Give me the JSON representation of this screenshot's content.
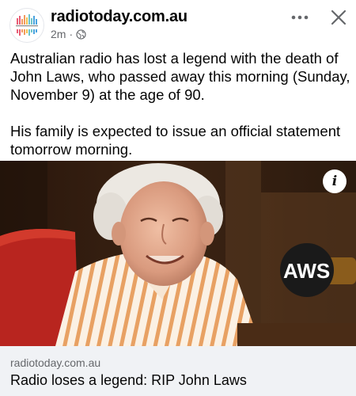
{
  "header": {
    "page_name": "radiotoday.com.au",
    "timestamp": "2m",
    "separator": "·",
    "logo_text_top": "RADIO TODAY",
    "logo_text_bottom": "RADIO TODAY",
    "more_icon": "more-horizontal-icon",
    "close_icon": "close-icon",
    "audience_icon": "globe-icon"
  },
  "post": {
    "paragraph_1": "Australian radio has lost a legend with the death of John Laws, who passed away this morning (Sunday, November 9) at the age of 90.",
    "paragraph_2": "His family is expected to issue an official statement tomorrow morning."
  },
  "media": {
    "badge_text": "AWS",
    "info_icon": "info-icon",
    "info_label": "i"
  },
  "link_card": {
    "domain": "radiotoday.com.au",
    "title": "Radio loses a legend: RIP John Laws"
  },
  "colors": {
    "secondary_text": "#65676b",
    "card_background": "#f0f2f5",
    "logo_bars": [
      "#e85d75",
      "#f29a5c",
      "#6cc3c9",
      "#4aa3df"
    ]
  }
}
